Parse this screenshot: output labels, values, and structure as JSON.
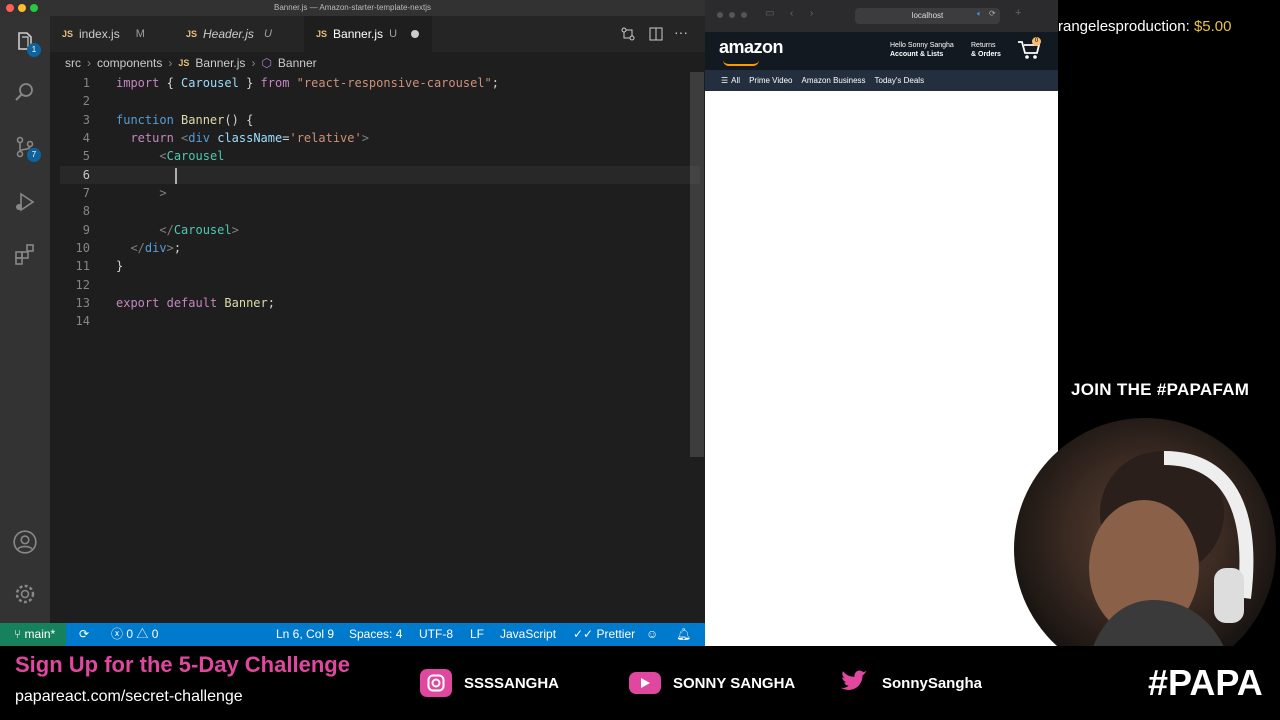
{
  "vscode": {
    "window_title": "Banner.js — Amazon-starter-template-nextjs",
    "tabs": [
      {
        "label": "index.js",
        "status": "M"
      },
      {
        "label": "Header.js",
        "status": "U"
      },
      {
        "label": "Banner.js",
        "status": "U"
      }
    ],
    "breadcrumb": [
      "src",
      "components",
      "Banner.js",
      "Banner"
    ],
    "activity_badges": {
      "explorer": "1",
      "source_control": "7"
    },
    "line_numbers": [
      "1",
      "2",
      "3",
      "4",
      "5",
      "6",
      "7",
      "8",
      "9",
      "10",
      "11",
      "12",
      "13",
      "14"
    ],
    "status": {
      "branch": "main*",
      "errors": "0",
      "warnings": "0",
      "position": "Ln 6, Col 9",
      "spaces": "Spaces: 4",
      "encoding": "UTF-8",
      "eol": "LF",
      "language": "JavaScript",
      "formatter": "Prettier"
    }
  },
  "browser": {
    "url": "localhost",
    "logo": "amazon",
    "hello_line1": "Hello Sonny Sangha",
    "hello_line2": "Account & Lists",
    "returns_line1": "Returns",
    "returns_line2": "& Orders",
    "cart_count": "0",
    "nav": [
      "All",
      "Prime Video",
      "Amazon Business",
      "Today's Deals"
    ]
  },
  "overlay": {
    "tip_name": "rangelesproduction:",
    "tip_amount": "$5.00",
    "join": "JOIN THE #PAPAFAM",
    "signup": "Sign Up for the 5-Day Challenge",
    "signup_url": "papareact.com/secret-challenge",
    "instagram": "SSSSANGHA",
    "youtube": "SONNY SANGHA",
    "twitter": "SonnySangha",
    "brand": "#PAPA"
  },
  "colors": {
    "status_bar": "#007acc",
    "amazon_header": "#131921",
    "amazon_nav": "#232f3e",
    "signup_pink": "#e0479e"
  }
}
